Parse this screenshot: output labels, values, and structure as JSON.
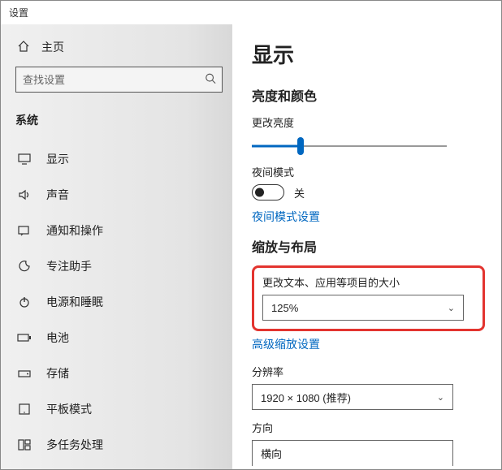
{
  "window": {
    "title": "设置"
  },
  "sidebar": {
    "home": "主页",
    "search_placeholder": "查找设置",
    "group": "系统",
    "items": [
      {
        "icon": "display",
        "label": "显示"
      },
      {
        "icon": "sound",
        "label": "声音"
      },
      {
        "icon": "notifications",
        "label": "通知和操作"
      },
      {
        "icon": "focus",
        "label": "专注助手"
      },
      {
        "icon": "power",
        "label": "电源和睡眠"
      },
      {
        "icon": "battery",
        "label": "电池"
      },
      {
        "icon": "storage",
        "label": "存储"
      },
      {
        "icon": "tablet",
        "label": "平板模式"
      },
      {
        "icon": "multitask",
        "label": "多任务处理"
      }
    ]
  },
  "content": {
    "title": "显示",
    "brightness_section": "亮度和颜色",
    "brightness_label": "更改亮度",
    "brightness_value_percent": 25,
    "nightlight_label": "夜间模式",
    "nightlight_state": "关",
    "nightlight_settings_link": "夜间模式设置",
    "scale_section": "缩放与布局",
    "scale_label": "更改文本、应用等项目的大小",
    "scale_value": "125%",
    "advanced_scaling_link": "高级缩放设置",
    "resolution_label": "分辨率",
    "resolution_value": "1920 × 1080 (推荐)",
    "orientation_label": "方向",
    "orientation_value": "横向"
  }
}
